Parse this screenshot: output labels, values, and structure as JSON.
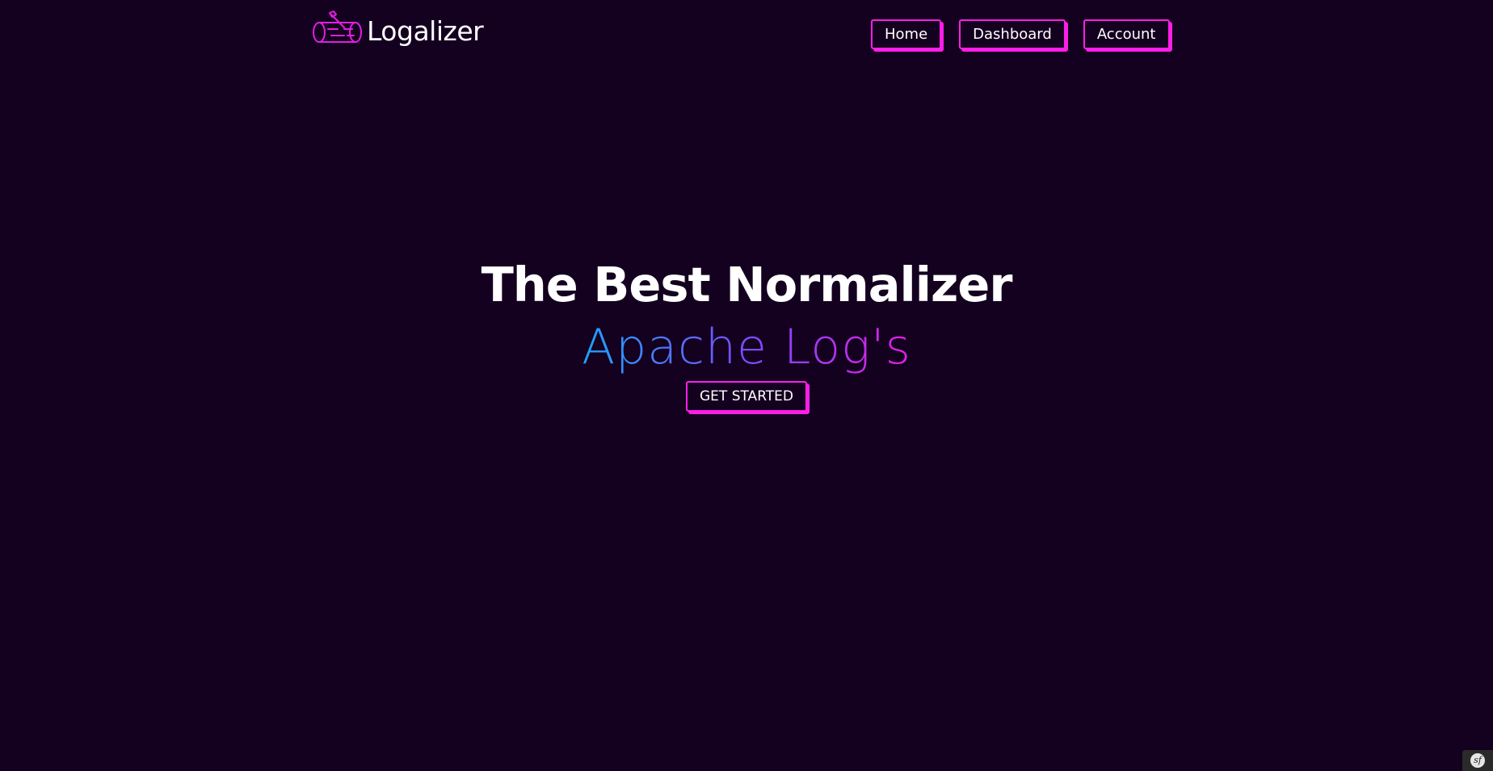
{
  "brand": {
    "name": "Logalizer",
    "logo_icon": "log-axe-icon"
  },
  "nav": {
    "items": [
      {
        "label": "Home"
      },
      {
        "label": "Dashboard"
      },
      {
        "label": "Account"
      }
    ]
  },
  "hero": {
    "title": "The Best Normalizer",
    "subtitle": "Apache Log's",
    "cta_label": "GET STARTED"
  },
  "footer": {
    "toolbar_icon": "symfony-icon",
    "toolbar_glyph": "sf"
  },
  "colors": {
    "background": "#14001f",
    "accent": "#ff1ee8",
    "gradient_start": "#1ea3ff",
    "gradient_mid": "#7a4cff",
    "gradient_end": "#e21ee0",
    "text": "#ffffff"
  }
}
